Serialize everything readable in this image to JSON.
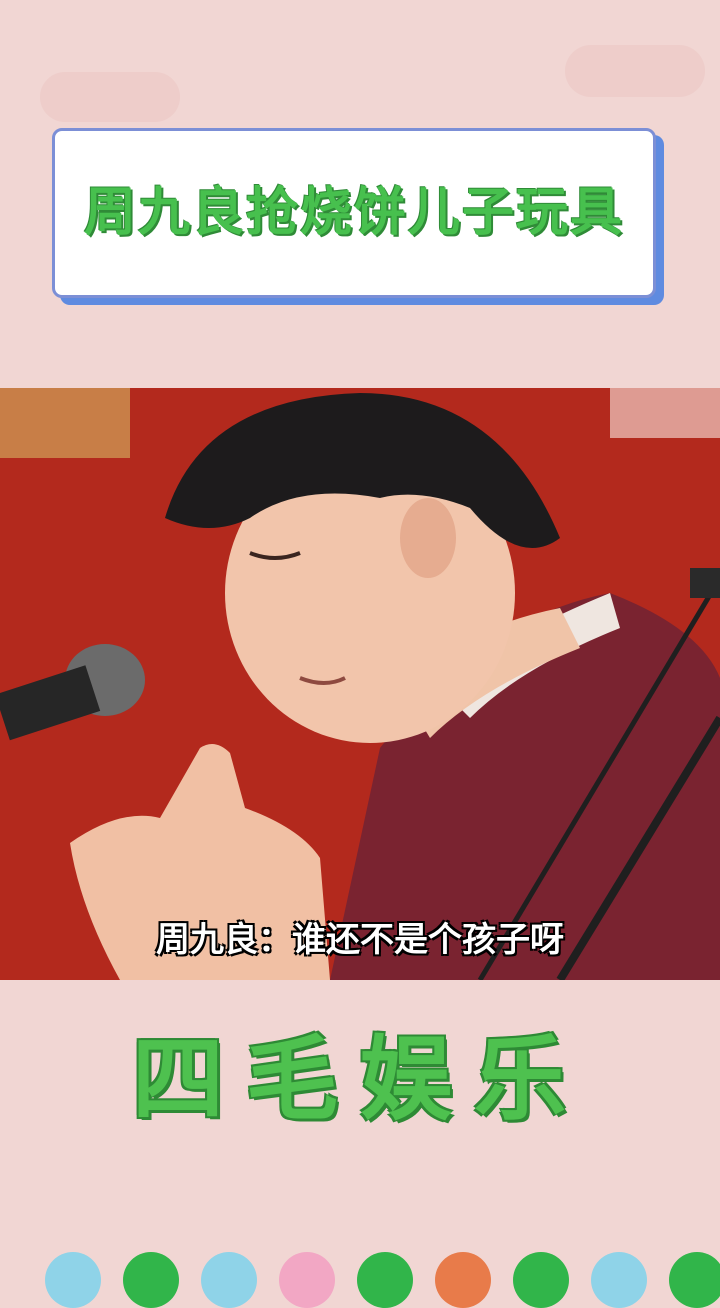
{
  "title": "周九良抢烧饼儿子玩具",
  "subtitle": "周九良：谁还不是个孩子呀",
  "brand": "四毛娱乐",
  "colors": {
    "background": "#f1d6d3",
    "title_green": "#47c04e",
    "card_border": "#7c8fd6",
    "card_shadow": "#5f8be0",
    "stage_red": "#b02b1f",
    "jacket": "#7a2330"
  },
  "decorative_dots": [
    "#8fd3e8",
    "#31b54a",
    "#8fd3e8",
    "#f2a7c4",
    "#31b54a",
    "#e87b4a",
    "#31b54a",
    "#8fd3e8",
    "#31b54a"
  ]
}
